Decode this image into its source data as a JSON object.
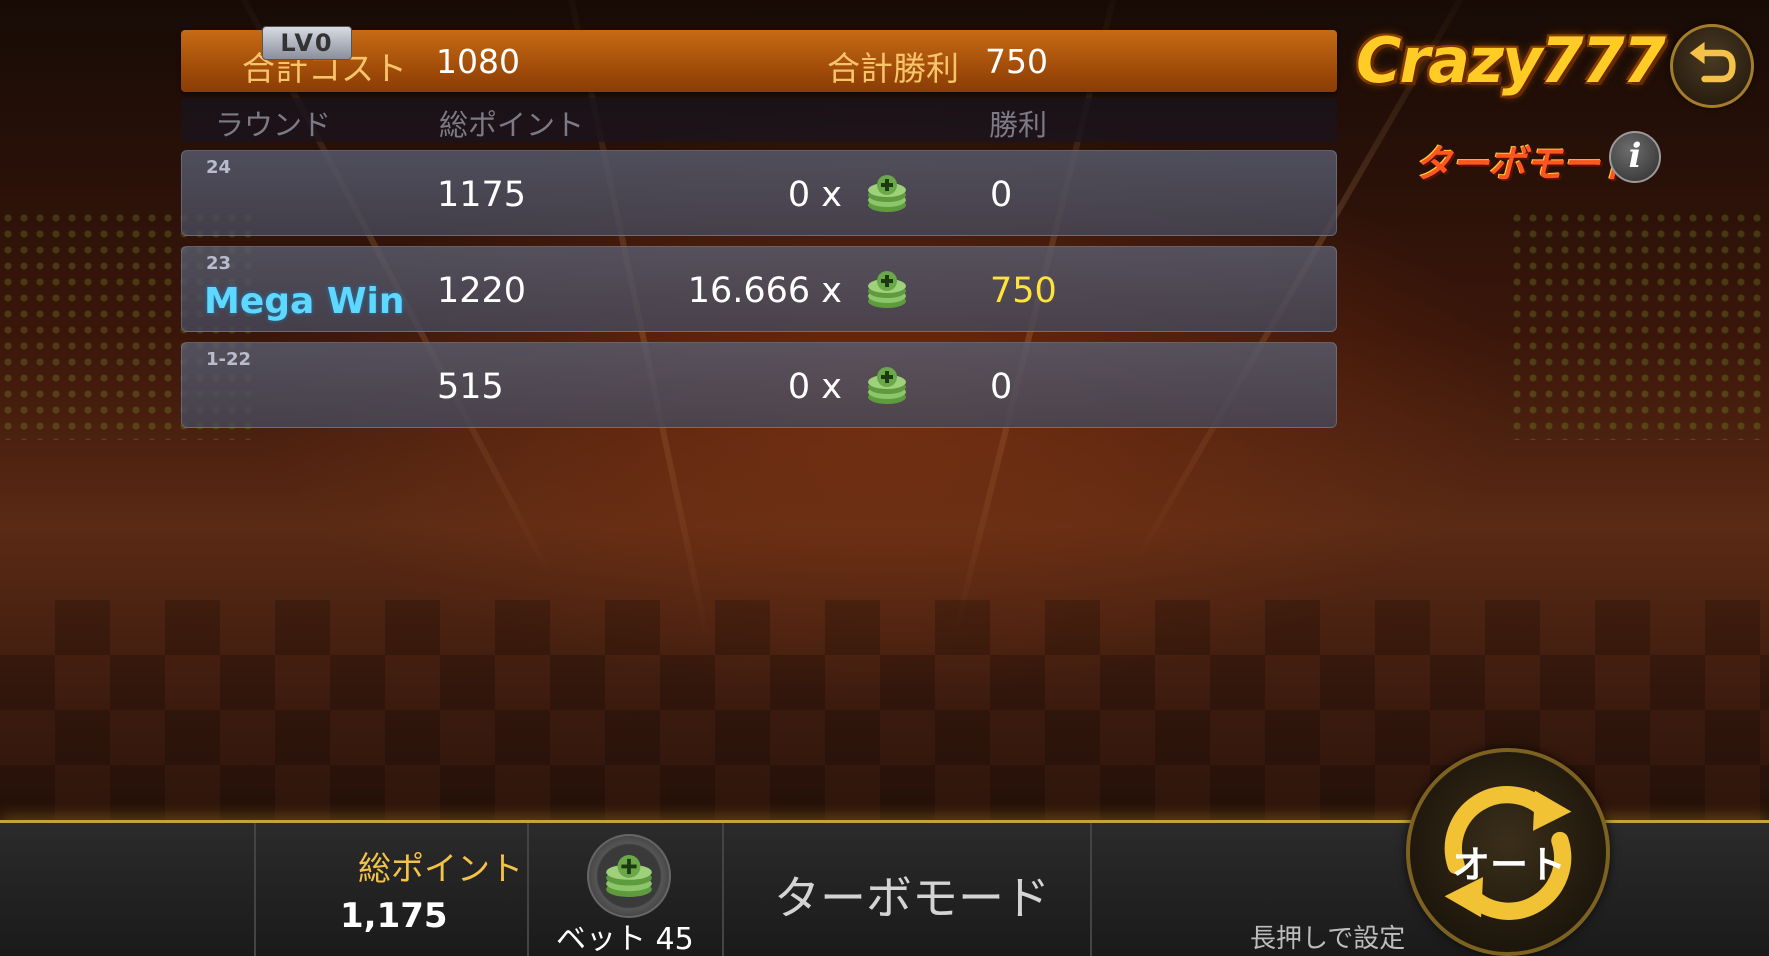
{
  "summary": {
    "total_cost_label": "合計コスト",
    "total_cost_value": "1080",
    "total_win_label": "合計勝利",
    "total_win_value": "750"
  },
  "columns": {
    "round": "ラウンド",
    "total_points": "総ポイント",
    "win": "勝利"
  },
  "rows": [
    {
      "round": "24",
      "badge": "",
      "points": "1175",
      "multiplier": "0 x",
      "win": "0",
      "win_color": "#ffffff"
    },
    {
      "round": "23",
      "badge": "Mega Win",
      "points": "1220",
      "multiplier": "16.666 x",
      "win": "750",
      "win_color": "#ffe23b"
    },
    {
      "round": "1-22",
      "badge": "",
      "points": "515",
      "multiplier": "0 x",
      "win": "0",
      "win_color": "#ffffff"
    }
  ],
  "logo": {
    "text": "Crazy777"
  },
  "turbo_mode_title": "ターボモード",
  "info_button": "i",
  "bottom": {
    "level_badge": "LV0",
    "total_points_label": "総ポイント",
    "total_points_value": "1,175",
    "bet_label": "ベット",
    "bet_value": "45",
    "turbo_mode_label": "ターボモード",
    "auto_label": "オート",
    "hold_hint": "長押しで設定"
  },
  "colors": {
    "accent_orange": "#c76b14",
    "mega_win": "#5fd8ff",
    "win_highlight": "#ffe23b",
    "gold_border": "#c9a13b"
  },
  "icons": [
    "back-arrow-icon",
    "info-icon",
    "chip-stack-icon",
    "auto-refresh-icon"
  ]
}
